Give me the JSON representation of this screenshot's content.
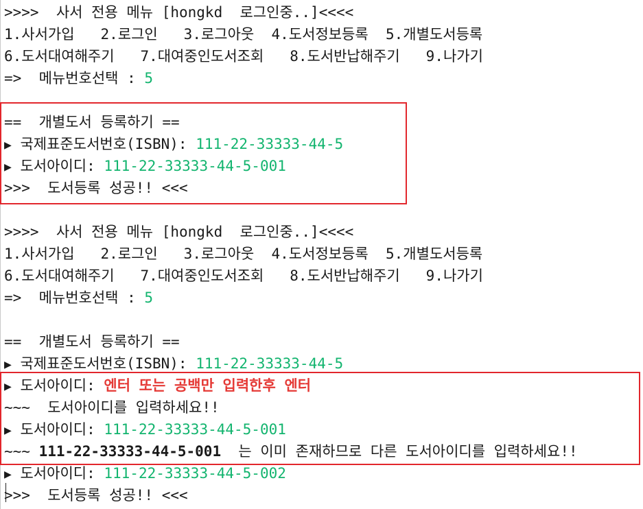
{
  "colors": {
    "input": "#12b46e",
    "highlight": "#e53935",
    "box_border": "#e2262c"
  },
  "session1": {
    "header": ">>>>  사서 전용 메뉴 [hongkd  로그인중..]<<<<",
    "menu_row1": "1.사서가입   2.로그인   3.로그아웃  4.도서정보등록  5.개별도서등록",
    "menu_row2": "6.도서대여해주기   7.대여중인도서조회   8.도서반납해주기   9.나가기",
    "select_prompt": "=>  메뉴번호선택 : ",
    "select_value": "5",
    "section_title": "==  개별도서 등록하기 ==",
    "arrow": "▶",
    "isbn_label": " 국제표준도서번호(ISBN): ",
    "isbn_value": "111-22-33333-44-5",
    "bookid_label": " 도서아이디: ",
    "bookid_value": "111-22-33333-44-5-001",
    "success": ">>>  도서등록 성공!! <<<"
  },
  "session2": {
    "header": ">>>>  사서 전용 메뉴 [hongkd  로그인중..]<<<<",
    "menu_row1": "1.사서가입   2.로그인   3.로그아웃  4.도서정보등록  5.개별도서등록",
    "menu_row2": "6.도서대여해주기   7.대여중인도서조회   8.도서반납해주기   9.나가기",
    "select_prompt": "=>  메뉴번호선택 : ",
    "select_value": "5",
    "section_title": "==  개별도서 등록하기 ==",
    "arrow": "▶",
    "isbn_label": " 국제표준도서번호(ISBN): ",
    "isbn_value": "111-22-33333-44-5",
    "bookid_label": " 도서아이디: ",
    "empty_note": "엔터 또는 공백만 입력한후 엔터",
    "error_empty": "~~~  도서아이디를 입력하세요!!",
    "retry_value": "111-22-33333-44-5-001",
    "dup_prefix": "~~~ ",
    "dup_id": "111-22-33333-44-5-001",
    "dup_message": "  는 이미 존재하므로 다른 도서아이디를 입력하세요!!",
    "final_value": "111-22-33333-44-5-002",
    "success": ">>>  도서등록 성공!! <<<"
  }
}
